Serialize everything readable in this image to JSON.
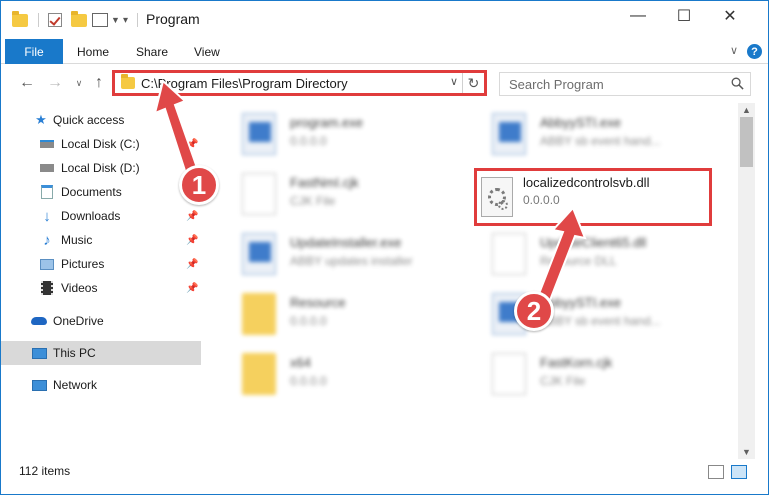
{
  "window": {
    "title": "Program",
    "controls": {
      "minimize": "—",
      "maximize": "☐",
      "close": "✕"
    }
  },
  "ribbon": {
    "file": "File",
    "home": "Home",
    "share": "Share",
    "view": "View",
    "help": "?"
  },
  "address": {
    "path": "C:\\Program Files\\Program Directory",
    "search_placeholder": "Search Program"
  },
  "nav": {
    "items": [
      {
        "label": "Quick access",
        "icon": "star-icon"
      },
      {
        "label": "Local Disk (C:)",
        "icon": "drive-icon"
      },
      {
        "label": "Local Disk (D:)",
        "icon": "drive-icon"
      },
      {
        "label": "Documents",
        "icon": "documents-icon"
      },
      {
        "label": "Downloads",
        "icon": "download-icon"
      },
      {
        "label": "Music",
        "icon": "music-icon"
      },
      {
        "label": "Pictures",
        "icon": "pictures-icon"
      },
      {
        "label": "Videos",
        "icon": "videos-icon"
      },
      {
        "label": "OneDrive",
        "icon": "cloud-icon"
      },
      {
        "label": "This PC",
        "icon": "computer-icon"
      },
      {
        "label": "Network",
        "icon": "network-icon"
      }
    ]
  },
  "files": [
    {
      "name": "program.exe",
      "desc": "0.0.0.0"
    },
    {
      "name": "AbbyySTI.exe",
      "desc": "ABBY sb event hand..."
    },
    {
      "name": "FastNmI.cjk",
      "desc": "CJK File"
    },
    {
      "name": "localizedcontrolsvb.dll",
      "desc": "0.0.0.0"
    },
    {
      "name": "UpdateInstaller.exe",
      "desc": "ABBY updates installer"
    },
    {
      "name": "UpdateClient65.dll",
      "desc": "Resource DLL"
    },
    {
      "name": "Resource",
      "desc": "0.0.0.0"
    },
    {
      "name": "AbbyySTI.exe",
      "desc": "ABBY sb event hand..."
    },
    {
      "name": "x64",
      "desc": "0.0.0.0"
    },
    {
      "name": "FastKorn.cjk",
      "desc": "CJK File"
    }
  ],
  "status": {
    "count": "112 items"
  },
  "annotations": {
    "step1": "1",
    "step2": "2"
  },
  "colors": {
    "accent": "#1979ca",
    "highlight": "#e03c3c",
    "badge": "#e04848"
  }
}
